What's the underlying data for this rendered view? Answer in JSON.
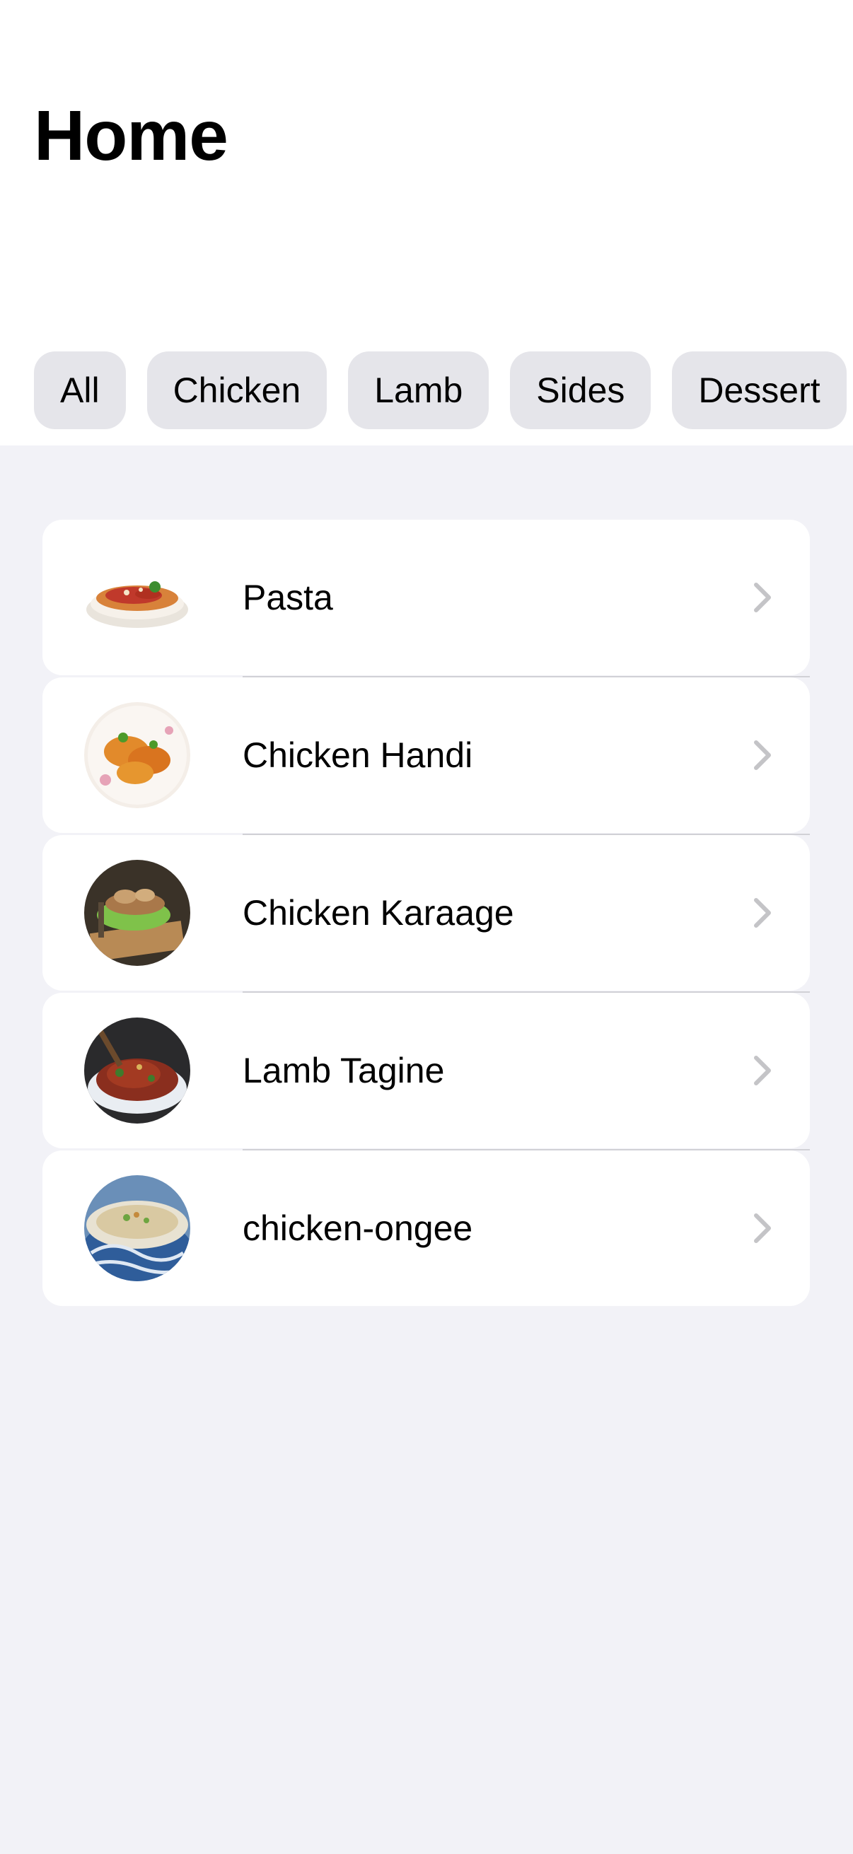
{
  "page_title": "Home",
  "filters": [
    {
      "label": "All"
    },
    {
      "label": "Chicken"
    },
    {
      "label": "Lamb"
    },
    {
      "label": "Sides"
    },
    {
      "label": "Dessert"
    }
  ],
  "recipes": [
    {
      "name": "Pasta",
      "icon": "pasta-thumbnail"
    },
    {
      "name": "Chicken Handi",
      "icon": "chicken-handi-thumbnail"
    },
    {
      "name": "Chicken Karaage",
      "icon": "chicken-karaage-thumbnail"
    },
    {
      "name": "Lamb Tagine",
      "icon": "lamb-tagine-thumbnail"
    },
    {
      "name": "chicken-ongee",
      "icon": "chicken-ongee-thumbnail"
    }
  ],
  "colors": {
    "background": "#f2f2f7",
    "card": "#ffffff",
    "chip": "#e5e5ea",
    "chevron": "#c4c4c7",
    "separator": "#d1d1d6"
  }
}
